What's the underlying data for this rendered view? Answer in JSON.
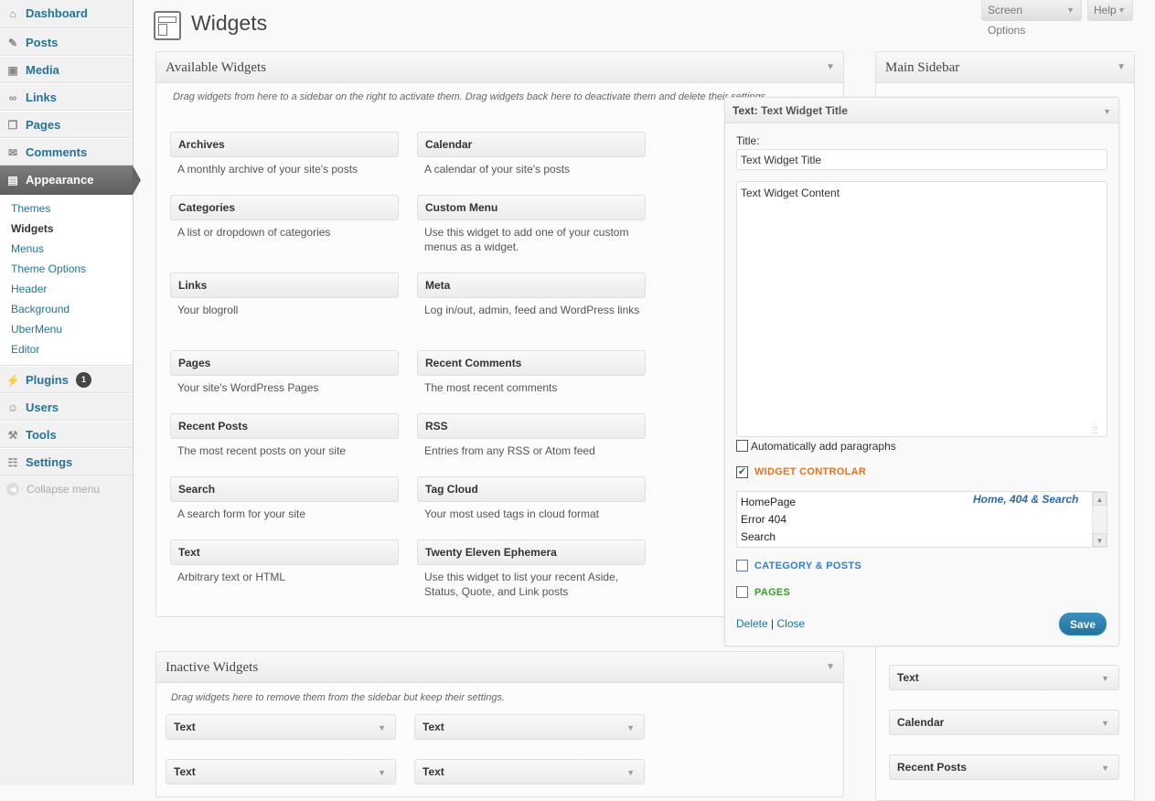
{
  "menu": {
    "top_items_before": [
      {
        "label": "Dashboard",
        "icon": "dashboard-icon"
      },
      {
        "label": "Posts",
        "icon": "posts-pin-icon"
      },
      {
        "label": "Media",
        "icon": "media-icon"
      },
      {
        "label": "Links",
        "icon": "links-icon"
      },
      {
        "label": "Pages",
        "icon": "pages-icon"
      },
      {
        "label": "Comments",
        "icon": "comments-icon"
      }
    ],
    "current": {
      "label": "Appearance",
      "icon": "appearance-icon"
    },
    "submenu": [
      {
        "label": "Themes"
      },
      {
        "label": "Widgets"
      },
      {
        "label": "Menus"
      },
      {
        "label": "Theme Options"
      },
      {
        "label": "Header"
      },
      {
        "label": "Background"
      },
      {
        "label": "UberMenu"
      },
      {
        "label": "Editor"
      }
    ],
    "plugins": {
      "label": "Plugins",
      "badge": "1",
      "icon": "plugins-icon"
    },
    "users": {
      "label": "Users",
      "icon": "users-icon"
    },
    "tools": {
      "label": "Tools",
      "icon": "tools-icon"
    },
    "settings": {
      "label": "Settings",
      "icon": "settings-icon"
    },
    "collapse": "Collapse menu"
  },
  "header": {
    "title": "Widgets",
    "screen_options": "Screen Options",
    "help": "Help"
  },
  "available": {
    "title": "Available Widgets",
    "description": "Drag widgets from here to a sidebar on the right to activate them. Drag widgets back here to deactivate them and delete their settings.",
    "widgets": [
      {
        "title": "Archives",
        "desc": "A monthly archive of your site's posts"
      },
      {
        "title": "Calendar",
        "desc": "A calendar of your site's posts"
      },
      {
        "title": "Categories",
        "desc": "A list or dropdown of categories"
      },
      {
        "title": "Custom Menu",
        "desc": "Use this widget to add one of your custom menus as a widget."
      },
      {
        "title": "Links",
        "desc": "Your blogroll"
      },
      {
        "title": "Meta",
        "desc": "Log in/out, admin, feed and WordPress links"
      },
      {
        "title": "Pages",
        "desc": "Your site's WordPress Pages"
      },
      {
        "title": "Recent Comments",
        "desc": "The most recent comments"
      },
      {
        "title": "Recent Posts",
        "desc": "The most recent posts on your site"
      },
      {
        "title": "RSS",
        "desc": "Entries from any RSS or Atom feed"
      },
      {
        "title": "Search",
        "desc": "A search form for your site"
      },
      {
        "title": "Tag Cloud",
        "desc": "Your most used tags in cloud format"
      },
      {
        "title": "Text",
        "desc": "Arbitrary text or HTML"
      },
      {
        "title": "Twenty Eleven Ephemera",
        "desc": "Use this widget to list your recent Aside, Status, Quote, and Link posts"
      }
    ]
  },
  "inactive": {
    "title": "Inactive Widgets",
    "description": "Drag widgets here to remove them from the sidebar but keep their settings.",
    "widgets": [
      "Text",
      "Text",
      "Text",
      "Text"
    ]
  },
  "sidebar": {
    "title": "Main Sidebar",
    "widgets": [
      "Text",
      "Calendar",
      "Recent Posts"
    ]
  },
  "open_widget": {
    "type_label": "Text:",
    "instance_title": "Text Widget Title",
    "title_label": "Title:",
    "title_value": "Text Widget Title",
    "content_value": "Text Widget Content",
    "auto_paragraphs": "Automatically add paragraphs",
    "auto_paragraphs_checked": false,
    "controlar_label": "WIDGET CONTROLAR",
    "controlar_checked": true,
    "controlar_color": "#e8731f",
    "list_options": [
      "HomePage",
      "Error 404",
      "Search"
    ],
    "list_summary": "Home, 404 & Search",
    "category_label": "CATEGORY & POSTS",
    "category_color": "#2a7fd4",
    "category_checked": false,
    "pages_label": "PAGES",
    "pages_color": "#3a9a2a",
    "pages_checked": false,
    "delete": "Delete",
    "separator": "|",
    "close": "Close",
    "save": "Save"
  },
  "colors": {
    "link": "#21759b",
    "menu_current_bg": "#6d6d6d"
  }
}
